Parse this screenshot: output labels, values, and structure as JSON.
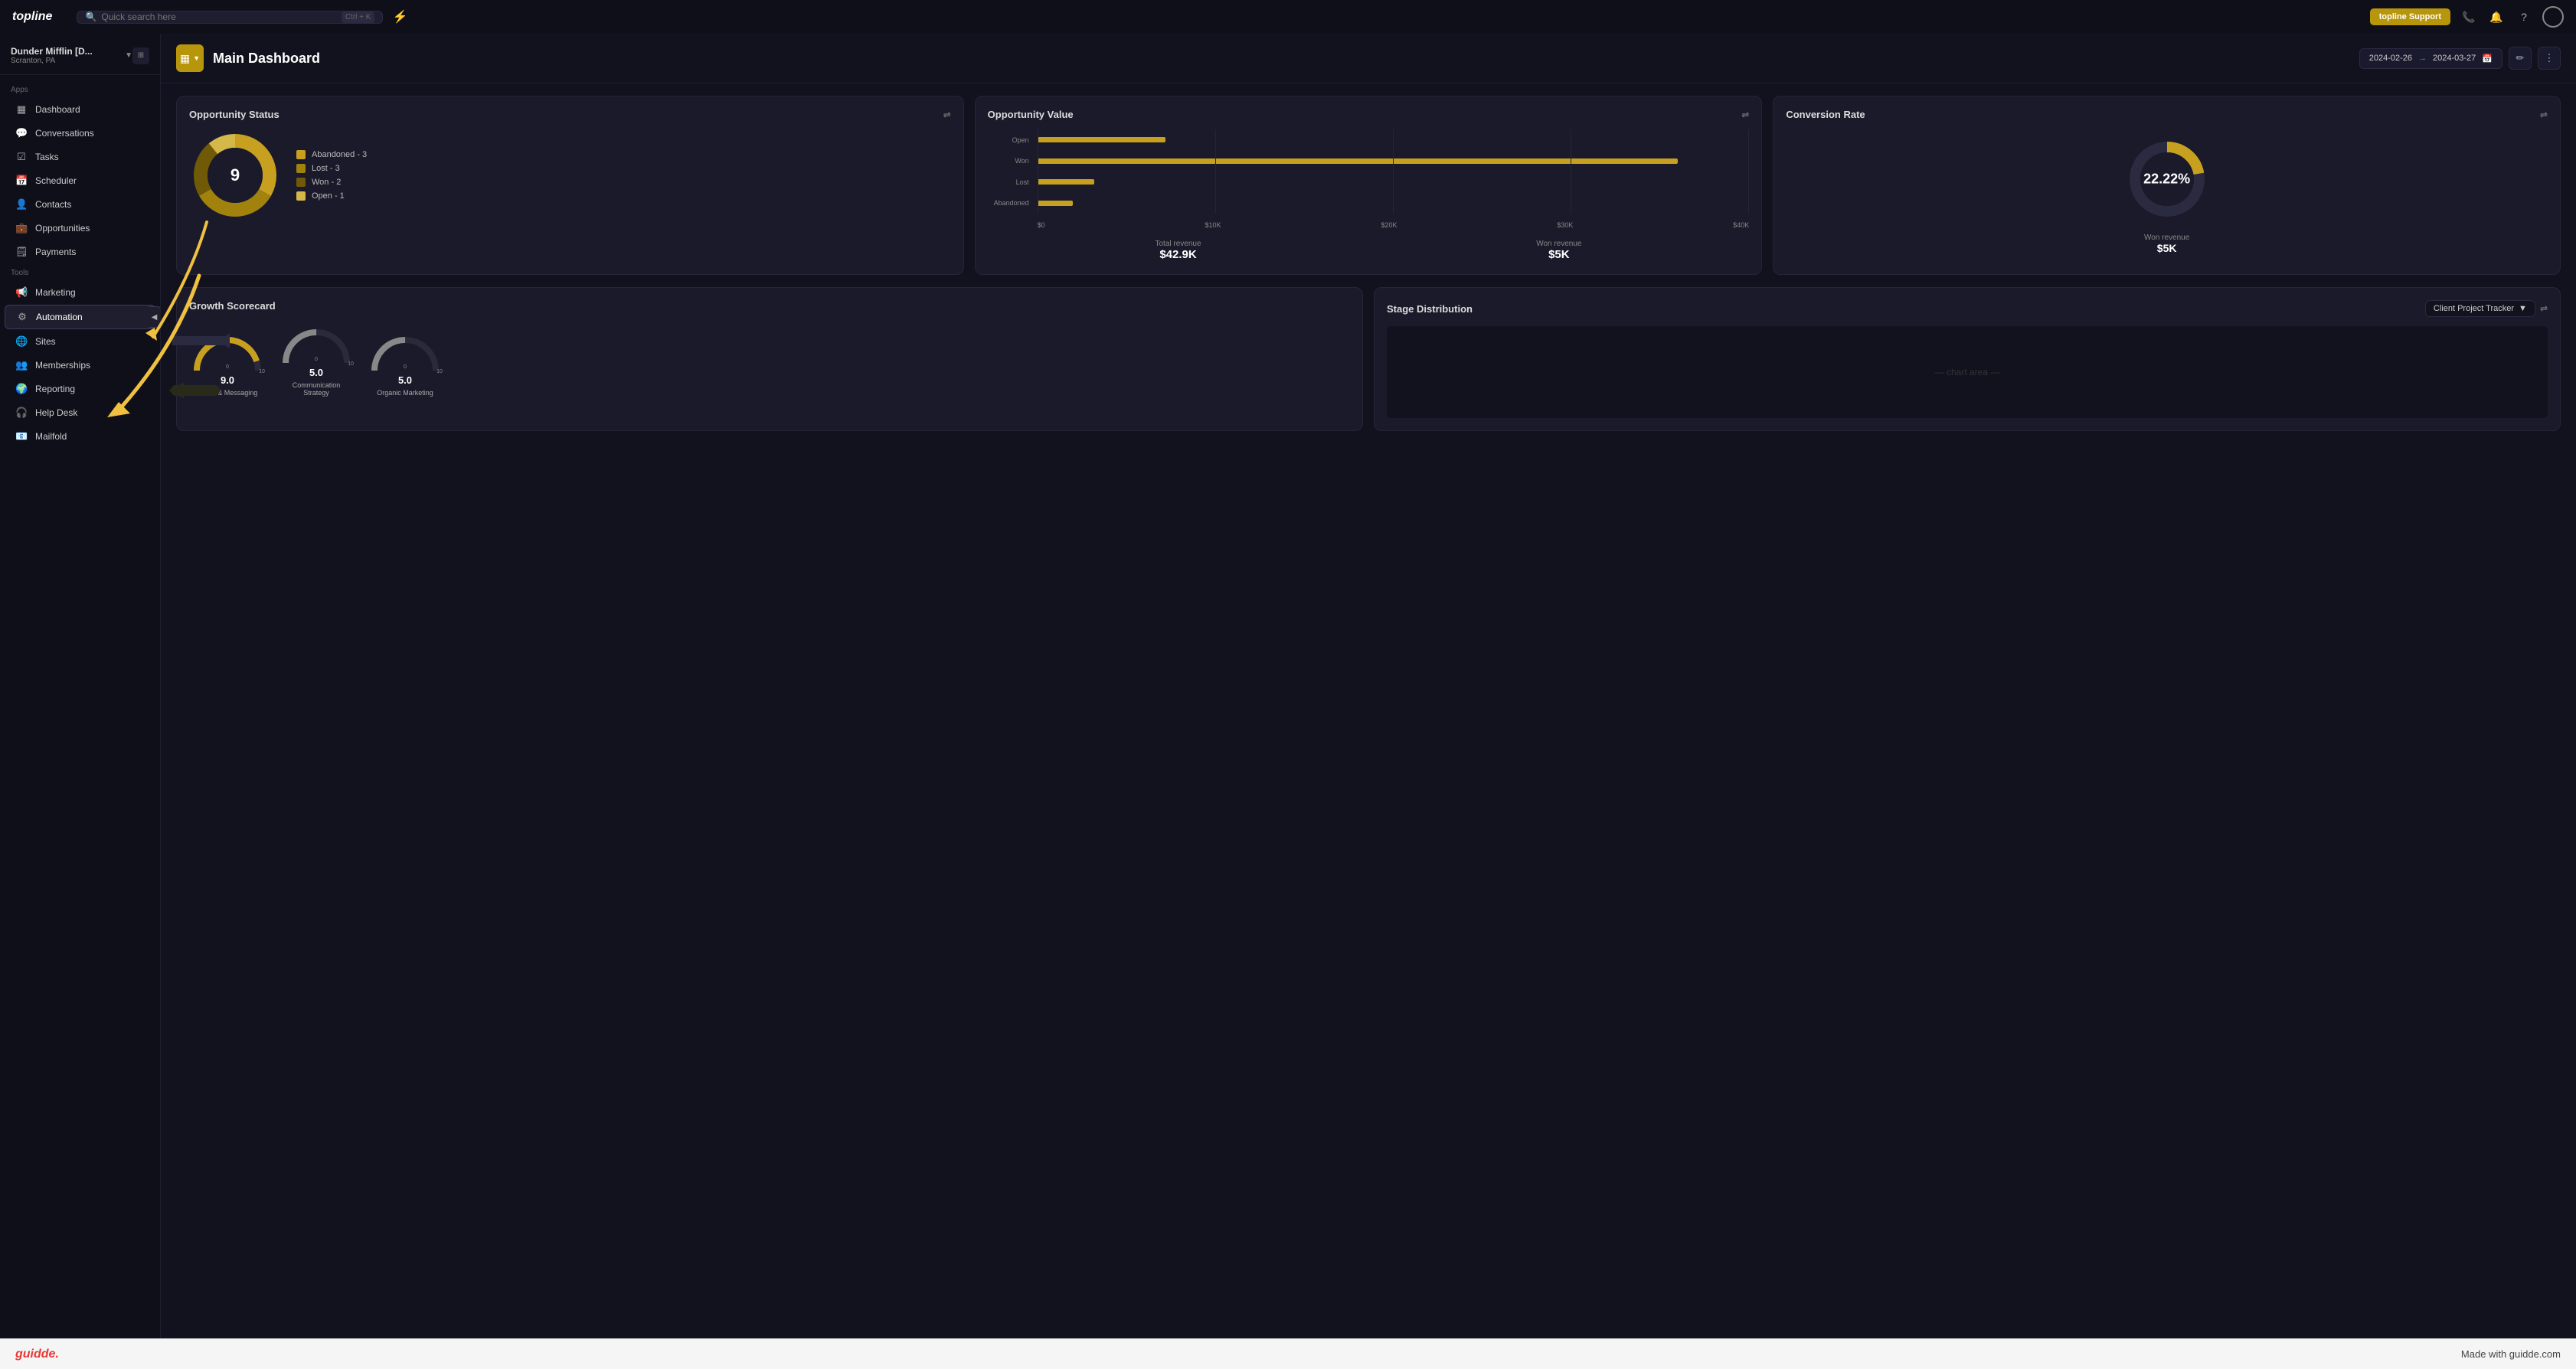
{
  "topnav": {
    "logo": "topline",
    "search_placeholder": "Quick search here",
    "search_shortcut": "Ctrl + K",
    "support_btn": "topline Support",
    "lightning_icon": "⚡"
  },
  "sidebar": {
    "workspace_name": "Dunder Mifflin [D...",
    "workspace_sub": "Scranton, PA",
    "apps_label": "Apps",
    "tools_label": "Tools",
    "items_apps": [
      {
        "id": "dashboard",
        "label": "Dashboard",
        "icon": "▦"
      },
      {
        "id": "conversations",
        "label": "Conversations",
        "icon": "💬"
      },
      {
        "id": "tasks",
        "label": "Tasks",
        "icon": "☑"
      },
      {
        "id": "scheduler",
        "label": "Scheduler",
        "icon": "📅"
      },
      {
        "id": "contacts",
        "label": "Contacts",
        "icon": "👤"
      },
      {
        "id": "opportunities",
        "label": "Opportunities",
        "icon": "💼"
      },
      {
        "id": "payments",
        "label": "Payments",
        "icon": "🗒"
      }
    ],
    "items_tools": [
      {
        "id": "marketing",
        "label": "Marketing",
        "icon": "📢"
      },
      {
        "id": "automation",
        "label": "Automation",
        "icon": "⚙",
        "active": true
      },
      {
        "id": "sites",
        "label": "Sites",
        "icon": "🌐"
      },
      {
        "id": "memberships",
        "label": "Memberships",
        "icon": "👥"
      },
      {
        "id": "reporting",
        "label": "Reporting",
        "icon": "🌍"
      },
      {
        "id": "helpdesk",
        "label": "Help Desk",
        "icon": "🎧"
      },
      {
        "id": "mailfold",
        "label": "Mailfold",
        "icon": "📧"
      }
    ]
  },
  "main": {
    "title": "Main Dashboard",
    "date_start": "2024-02-26",
    "date_end": "2024-03-27",
    "widgets": {
      "opp_status": {
        "title": "Opportunity Status",
        "total": "9",
        "legend": [
          {
            "label": "Abandoned - 3",
            "color": "#c8a020"
          },
          {
            "label": "Lost - 3",
            "color": "#a0820c"
          },
          {
            "label": "Won - 2",
            "color": "#705a08"
          },
          {
            "label": "Open - 1",
            "color": "#d4b84a"
          }
        ],
        "donut": {
          "segments": [
            {
              "value": 3,
              "color": "#c8a020"
            },
            {
              "value": 3,
              "color": "#a0820c"
            },
            {
              "value": 2,
              "color": "#705a08"
            },
            {
              "value": 1,
              "color": "#d4b84a"
            }
          ],
          "total": 9
        }
      },
      "opp_value": {
        "title": "Opportunity Value",
        "bars": [
          {
            "label": "Open",
            "width_pct": 18,
            "color": "#c8a020"
          },
          {
            "label": "Won",
            "width_pct": 100,
            "color": "#c8a020"
          },
          {
            "label": "Lost",
            "width_pct": 8,
            "color": "#c8a020"
          },
          {
            "label": "Abandoned",
            "width_pct": 5,
            "color": "#c8a020"
          }
        ],
        "x_labels": [
          "$0",
          "$10K",
          "$20K",
          "$30K",
          "$40K"
        ],
        "total_revenue_label": "Total revenue",
        "total_revenue_value": "$42.9K",
        "won_revenue_label": "Won revenue",
        "won_revenue_value": "$5K"
      },
      "conversion": {
        "title": "Conversion Rate",
        "percentage": "22.22%",
        "won_revenue_label": "Won revenue",
        "won_revenue_value": "$5K"
      },
      "growth_scorecard": {
        "title": "Growth Scorecard",
        "gauges": [
          {
            "label": "Brand & Messaging",
            "value": "9.0",
            "pct": 90
          },
          {
            "label": "Communication Strategy",
            "value": "5.0",
            "pct": 50
          },
          {
            "label": "Organic Marketing",
            "value": "5.0",
            "pct": 50
          }
        ]
      },
      "stage_distribution": {
        "title": "Stage Distribution",
        "dropdown": "Client Project Tracker"
      }
    }
  },
  "bottombar": {
    "logo": "guidde.",
    "tagline": "Made with guidde.com"
  }
}
